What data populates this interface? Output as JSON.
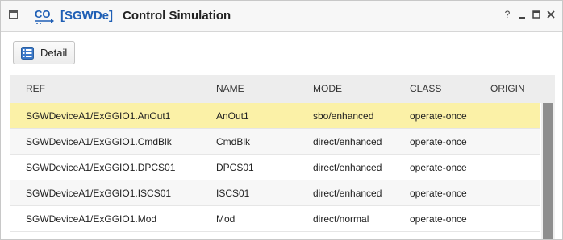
{
  "window": {
    "logo_text": "CO",
    "title_prefix": "[SGWDe]",
    "title": "Control Simulation",
    "controls": {
      "help": "?",
      "minimize": "_",
      "maximize": "□",
      "close": "✕"
    }
  },
  "toolbar": {
    "detail_label": "Detail"
  },
  "table": {
    "columns": [
      "REF",
      "NAME",
      "MODE",
      "CLASS",
      "ORIGIN"
    ],
    "rows": [
      {
        "ref": "SGWDeviceA1/ExGGIO1.AnOut1",
        "name": "AnOut1",
        "mode": "sbo/enhanced",
        "class": "operate-once",
        "origin": ""
      },
      {
        "ref": "SGWDeviceA1/ExGGIO1.CmdBlk",
        "name": "CmdBlk",
        "mode": "direct/enhanced",
        "class": "operate-once",
        "origin": ""
      },
      {
        "ref": "SGWDeviceA1/ExGGIO1.DPCS01",
        "name": "DPCS01",
        "mode": "direct/enhanced",
        "class": "operate-once",
        "origin": ""
      },
      {
        "ref": "SGWDeviceA1/ExGGIO1.ISCS01",
        "name": "ISCS01",
        "mode": "direct/enhanced",
        "class": "operate-once",
        "origin": ""
      },
      {
        "ref": "SGWDeviceA1/ExGGIO1.Mod",
        "name": "Mod",
        "mode": "direct/normal",
        "class": "operate-once",
        "origin": ""
      }
    ],
    "selected_row": 0
  },
  "colors": {
    "title_accent": "#1f5fb5",
    "selected_row": "#fbf1a7",
    "header_bg": "#ededed"
  },
  "icons": {
    "window_icon": "window-icon",
    "logo": "co-logo",
    "detail": "detail-list-icon"
  }
}
